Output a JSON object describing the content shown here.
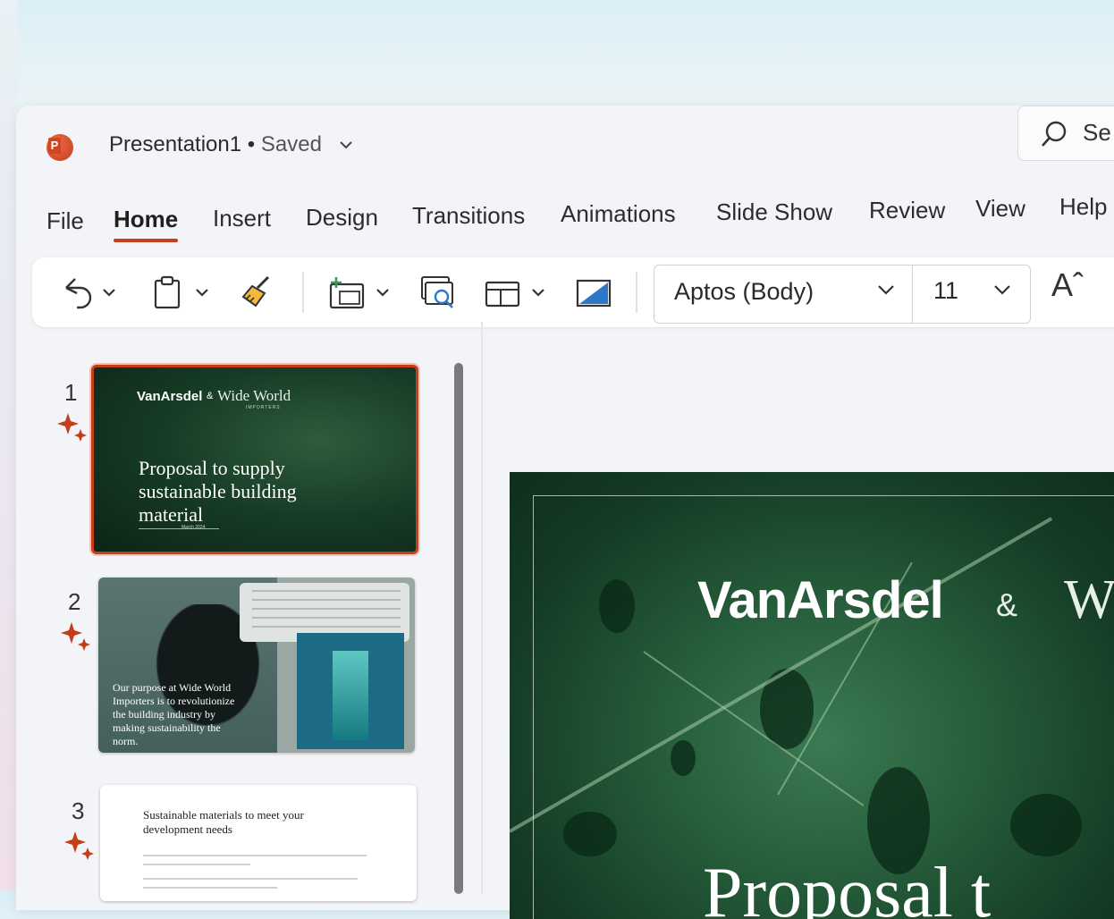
{
  "app": {
    "icon": "powerpoint-icon",
    "brand_color": "#c43e1c",
    "document_name": "Presentation1",
    "separator": "•",
    "status": "Saved",
    "search_placeholder": "Se"
  },
  "ribbon": {
    "tabs": [
      {
        "label": "File",
        "active": false
      },
      {
        "label": "Home",
        "active": true
      },
      {
        "label": "Insert",
        "active": false
      },
      {
        "label": "Design",
        "active": false
      },
      {
        "label": "Transitions",
        "active": false
      },
      {
        "label": "Animations",
        "active": false
      },
      {
        "label": "Slide Show",
        "active": false
      },
      {
        "label": "Review",
        "active": false
      },
      {
        "label": "View",
        "active": false
      },
      {
        "label": "Help",
        "active": false
      }
    ],
    "toolbar": {
      "icons": [
        "undo-icon",
        "paste-icon",
        "format-painter-icon",
        "new-slide-icon",
        "reuse-slides-icon",
        "layout-icon",
        "background-icon"
      ],
      "font_name": "Aptos (Body)",
      "font_size": "11",
      "grow_font_label": "Aˆ"
    }
  },
  "slides": [
    {
      "number": "1",
      "selected": true,
      "brand": "VanArsdel",
      "amp": "&",
      "partner": "Wide World",
      "partner_sub": "IMPORTERS",
      "title": "Proposal to supply sustainable building material",
      "date": "March 2024"
    },
    {
      "number": "2",
      "selected": false,
      "text": "Our purpose at Wide World Importers is to revolutionize the building industry by making sustainability the norm."
    },
    {
      "number": "3",
      "selected": false,
      "heading": "Sustainable materials to meet your development needs"
    }
  ],
  "main_slide": {
    "brand": "VanArsdel",
    "amp": "&",
    "partner_initial": "W",
    "title_fragment": "Proposal t"
  }
}
